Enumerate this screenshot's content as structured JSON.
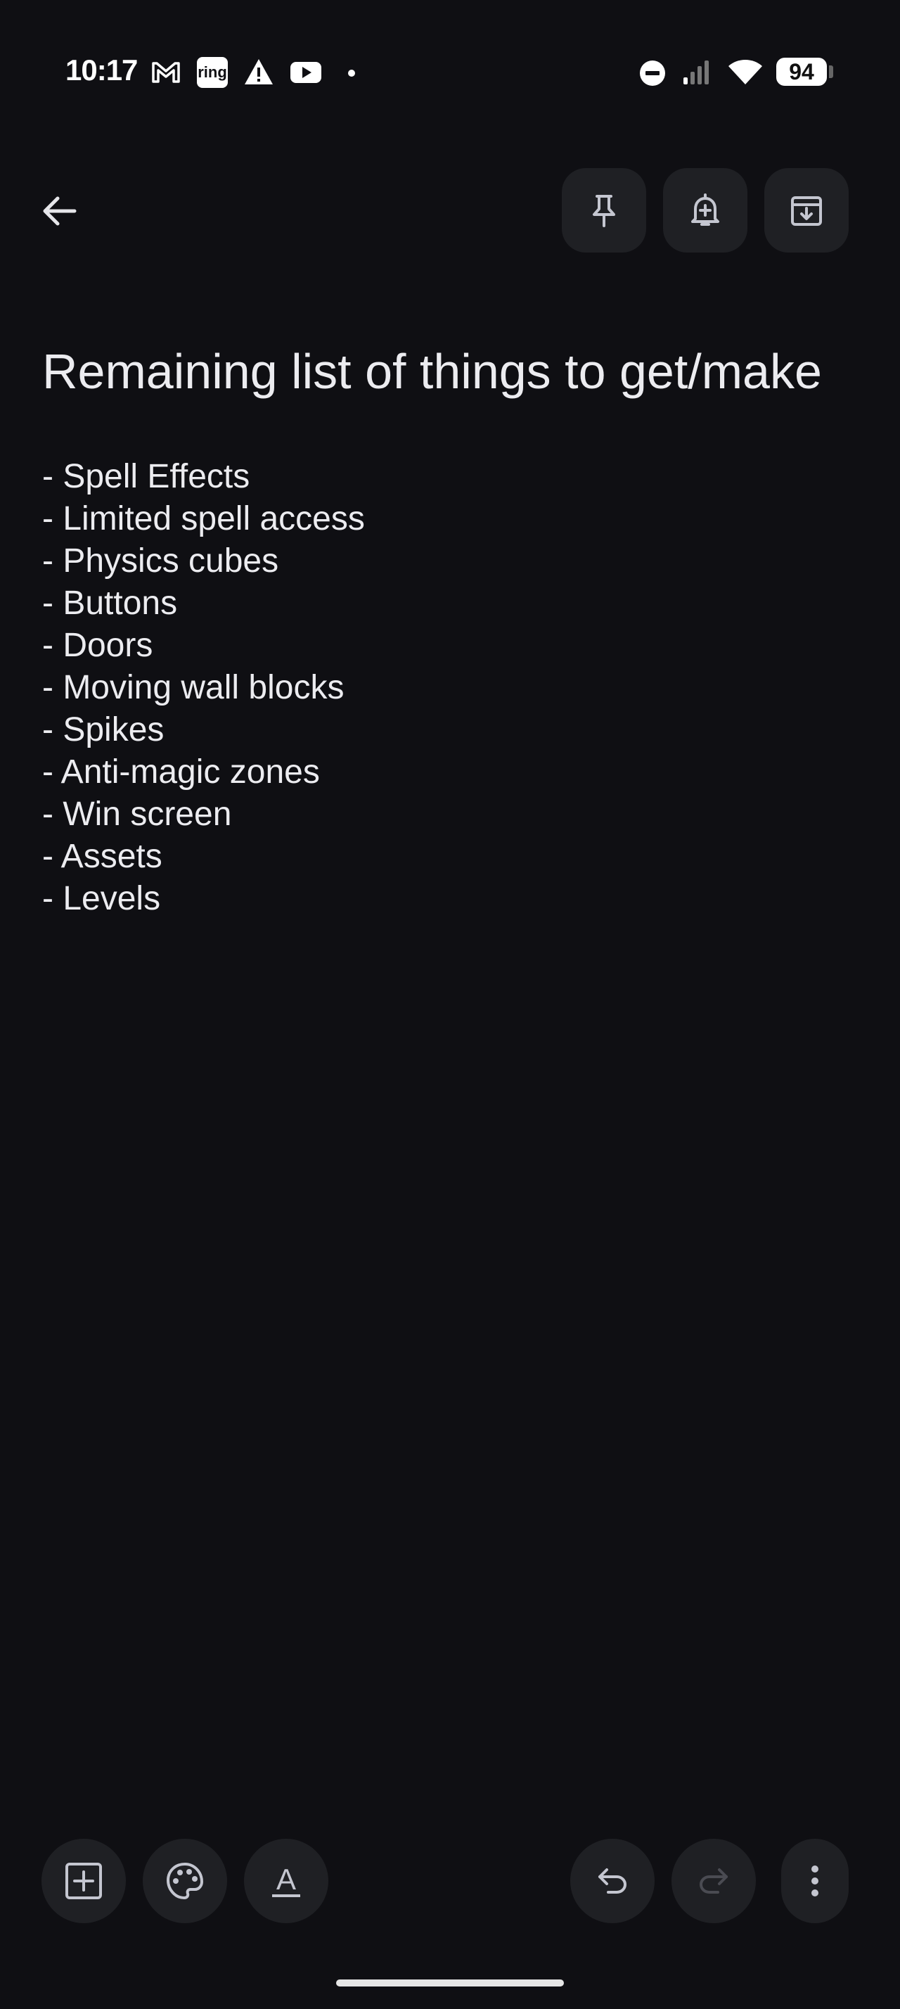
{
  "status_bar": {
    "time": "10:17",
    "ring_label": "ring",
    "battery": "94",
    "icons": [
      "gmail-icon",
      "ring-icon",
      "warning-icon",
      "youtube-icon",
      "dot-icon",
      "do-not-disturb-icon",
      "signal-icon",
      "wifi-icon",
      "battery-icon"
    ]
  },
  "toolbar": {
    "icons": [
      "back-arrow-icon",
      "pin-icon",
      "reminder-bell-icon",
      "archive-icon"
    ]
  },
  "note": {
    "title": "Remaining list of things to get/make",
    "lines": [
      "- Spell Effects",
      "- Limited spell access",
      "- Physics cubes",
      "- Buttons",
      "- Doors",
      "- Moving wall blocks",
      "- Spikes",
      "- Anti-magic zones",
      "- Win screen",
      "- Assets",
      "- Levels"
    ]
  },
  "bottom_bar": {
    "icons": [
      "add-box-icon",
      "palette-icon",
      "text-format-icon",
      "undo-icon",
      "redo-icon",
      "more-vert-icon"
    ],
    "format_glyph": "A"
  },
  "colors": {
    "background": "#0f0f13",
    "button_surface": "#1f2024",
    "text": "#ececf0",
    "icon": "#c4c6d0",
    "disabled_icon": "#4a4b52"
  }
}
